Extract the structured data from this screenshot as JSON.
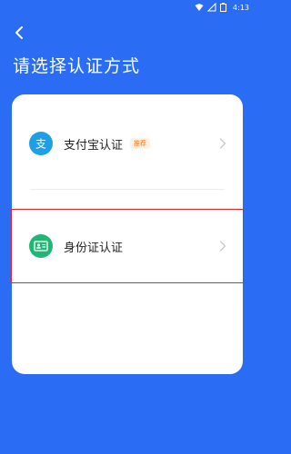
{
  "status_bar": {
    "time": "4:13"
  },
  "header": {
    "title": "请选择认证方式"
  },
  "options": [
    {
      "label": "支付宝认证",
      "badge": "推荐",
      "icon": "alipay-icon",
      "accent": "#1d9fe8"
    },
    {
      "label": "身份证认证",
      "icon": "id-card-icon",
      "accent": "#22b573",
      "selected": true
    }
  ],
  "colors": {
    "background": "#2a6df4",
    "card": "#ffffff",
    "badge_text": "#ff7a1a",
    "selection_outline": "#e0282e"
  }
}
